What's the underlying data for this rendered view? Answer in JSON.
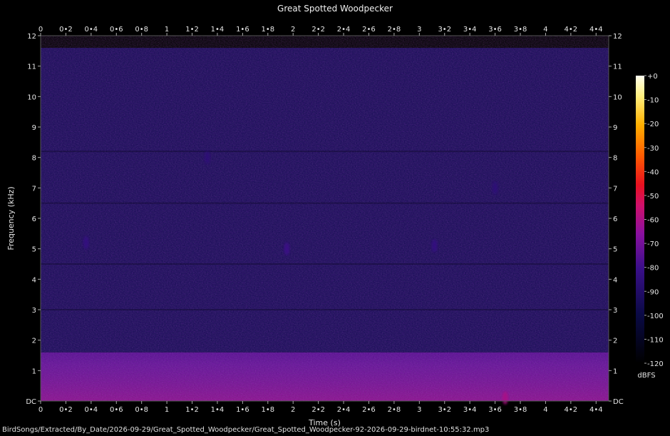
{
  "title": "Great Spotted Woodpecker",
  "filename": "BirdSongs/Extracted/By_Date/2026-09-29/Great_Spotted_Woodpecker/Great_Spotted_Woodpecker-92-2026-09-29-birdnet-10:55:32.mp3",
  "chart_data": {
    "type": "heatmap",
    "xlabel": "Time (s)",
    "ylabel": "Frequency (kHz)",
    "xlim": [
      0,
      4.5
    ],
    "ylim": [
      0,
      12
    ],
    "x_ticks": [
      "0",
      "0•2",
      "0•4",
      "0•6",
      "0•8",
      "1",
      "1•2",
      "1•4",
      "1•6",
      "1•8",
      "2",
      "2•2",
      "2•4",
      "2•6",
      "2•8",
      "3",
      "3•2",
      "3•4",
      "3•6",
      "3•8",
      "4",
      "4•2",
      "4•4"
    ],
    "y_ticks": [
      "DC",
      "1",
      "2",
      "3",
      "4",
      "5",
      "6",
      "7",
      "8",
      "9",
      "10",
      "11",
      "12"
    ],
    "colorbar": {
      "label": "dBFS",
      "range": [
        -120,
        0
      ],
      "ticks": [
        "+0",
        "-10",
        "-20",
        "-30",
        "-40",
        "-50",
        "-60",
        "-70",
        "-80",
        "-90",
        "-100",
        "-110",
        "-120"
      ]
    },
    "energy_bands": [
      {
        "freq_khz": [
          0,
          1.6
        ],
        "level_dbfs": -75
      },
      {
        "freq_khz": [
          1.6,
          11.6
        ],
        "level_dbfs": -95
      }
    ],
    "events": [
      {
        "time_s": 0.36,
        "freq_khz": 5.2,
        "level_dbfs": -82
      },
      {
        "time_s": 1.95,
        "freq_khz": 5.0,
        "level_dbfs": -80
      },
      {
        "time_s": 3.12,
        "freq_khz": 5.1,
        "level_dbfs": -82
      },
      {
        "time_s": 1.32,
        "freq_khz": 8.0,
        "level_dbfs": -85
      },
      {
        "time_s": 3.6,
        "freq_khz": 7.0,
        "level_dbfs": -85
      },
      {
        "time_s": 3.68,
        "freq_khz": 0.1,
        "level_dbfs": -60
      }
    ]
  }
}
